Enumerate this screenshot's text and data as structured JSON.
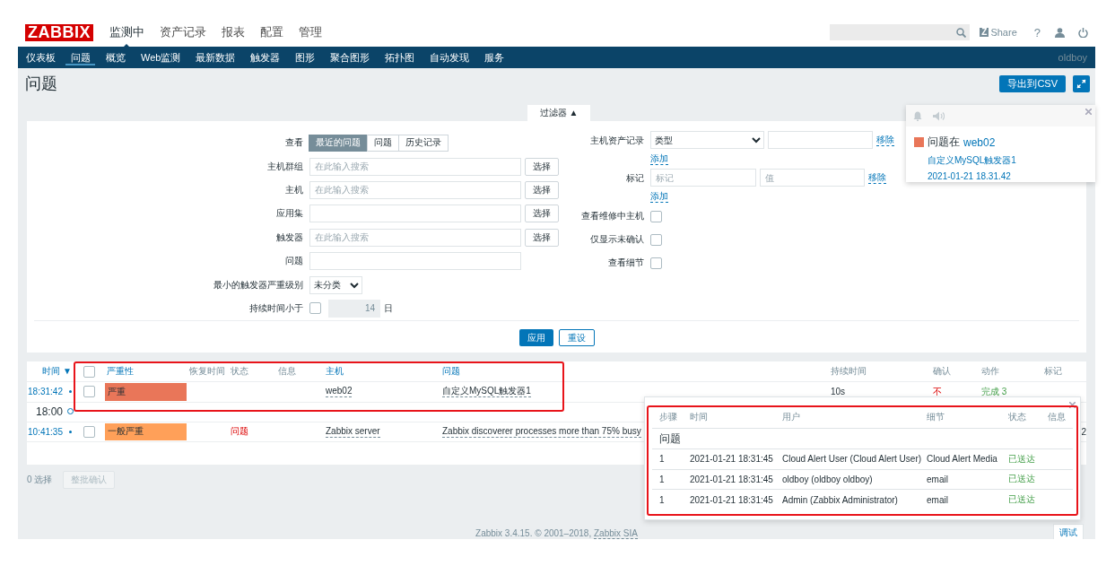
{
  "logo": "ZABBIX",
  "main_menu": [
    {
      "label": "监测中",
      "selected": true
    },
    {
      "label": "资产记录",
      "selected": false
    },
    {
      "label": "报表",
      "selected": false
    },
    {
      "label": "配置",
      "selected": false
    },
    {
      "label": "管理",
      "selected": false
    }
  ],
  "header_tools": {
    "share_badge": "Z",
    "share": "Share",
    "help": "?"
  },
  "sub_menu": [
    {
      "label": "仪表板",
      "selected": false
    },
    {
      "label": "问题",
      "selected": true
    },
    {
      "label": "概览",
      "selected": false
    },
    {
      "label": "Web监测",
      "selected": false
    },
    {
      "label": "最新数据",
      "selected": false
    },
    {
      "label": "触发器",
      "selected": false
    },
    {
      "label": "图形",
      "selected": false
    },
    {
      "label": "聚合图形",
      "selected": false
    },
    {
      "label": "拓扑图",
      "selected": false
    },
    {
      "label": "自动发现",
      "selected": false
    },
    {
      "label": "服务",
      "selected": false
    }
  ],
  "user": "oldboy",
  "page_title": "问题",
  "export_button": "导出到CSV",
  "filter": {
    "tab": "过滤器",
    "toggle": "▲",
    "left": [
      {
        "kind": "segmented",
        "label": "查看",
        "options": [
          {
            "label": "最近的问题",
            "selected": true
          },
          {
            "label": "问题",
            "selected": false
          },
          {
            "label": "历史记录",
            "selected": false
          }
        ]
      },
      {
        "kind": "search",
        "label": "主机群组",
        "placeholder": "在此输入搜索",
        "button": "选择"
      },
      {
        "kind": "search",
        "label": "主机",
        "placeholder": "在此输入搜索",
        "button": "选择"
      },
      {
        "kind": "search",
        "label": "应用集",
        "button": "选择"
      },
      {
        "kind": "search",
        "label": "触发器",
        "placeholder": "在此输入搜索",
        "button": "选择"
      },
      {
        "kind": "text",
        "label": "问题"
      },
      {
        "kind": "select",
        "label": "最小的触发器严重级别",
        "value": "未分类"
      },
      {
        "kind": "duration",
        "label": "持续时间小于",
        "checked": false,
        "value": "14",
        "unit": "日",
        "disabled": true
      }
    ],
    "right": [
      {
        "kind": "inventory",
        "label": "主机资产记录",
        "value": "类型",
        "remove": "移除",
        "add": "添加"
      },
      {
        "kind": "tags",
        "label": "标记",
        "tag_placeholder": "标记",
        "value_placeholder": "值",
        "remove": "移除",
        "add": "添加"
      },
      {
        "kind": "checkbox",
        "label": "查看维修中主机",
        "checked": false
      },
      {
        "kind": "checkbox",
        "label": "仅显示未确认",
        "checked": false
      },
      {
        "kind": "checkbox",
        "label": "查看细节",
        "checked": false
      }
    ],
    "apply": "应用",
    "reset": "重设"
  },
  "table": {
    "columns": [
      {
        "kind": "text",
        "label": "时间",
        "sortable": true,
        "sort_mark": "▼"
      },
      {
        "kind": "checkbox",
        "checked": false
      },
      {
        "kind": "text",
        "label": "严重性",
        "sortable": true
      },
      {
        "kind": "text",
        "label": "恢复时间",
        "sortable": false
      },
      {
        "kind": "text",
        "label": "状态",
        "sortable": false
      },
      {
        "kind": "text",
        "label": "信息",
        "sortable": false
      },
      {
        "kind": "text",
        "label": "主机",
        "sortable": true
      },
      {
        "kind": "text",
        "label": "问题",
        "sortable": true
      },
      {
        "kind": "text",
        "label": "持续时间",
        "sortable": false
      },
      {
        "kind": "text",
        "label": "确认",
        "sortable": false
      },
      {
        "kind": "text",
        "label": "动作",
        "sortable": false
      },
      {
        "kind": "text",
        "label": "标记",
        "sortable": false
      }
    ],
    "rows": [
      {
        "kind": "event",
        "time": "18:31:42",
        "checked": false,
        "severity": "严重",
        "color": "#e97659",
        "host": "web02",
        "problem": "自定义MySQL触发器1",
        "duration": "10s",
        "ack": "不",
        "actions": "完成 3"
      },
      {
        "kind": "marker",
        "time": "18:00"
      },
      {
        "kind": "event",
        "time": "10:41:35",
        "checked": false,
        "severity": "一般严重",
        "color": "#ffa059",
        "status": "问题",
        "host": "Zabbix server",
        "problem": "Zabbix discoverer processes more than 75% busy",
        "tags": "2"
      }
    ]
  },
  "selected_count": "0 选择",
  "mass_ack": {
    "label": "整批确认",
    "disabled": true
  },
  "footer": {
    "text": "Zabbix 3.4.15. © 2001–2018, ",
    "link": "Zabbix SIA",
    "debug": "调试"
  },
  "notification": {
    "color": "#e97659",
    "title": "问题在",
    "host": "web02",
    "trigger": "自定义MySQL触发器1",
    "time": "2021-01-21 18.31.42"
  },
  "actions_popup": {
    "columns": [
      "步骤",
      "时间",
      "用户",
      "细节",
      "状态",
      "信息"
    ],
    "section": "问题",
    "rows": [
      {
        "step": "1",
        "time": "2021-01-21 18:31:45",
        "user": "Cloud Alert User (Cloud Alert User)",
        "details": "Cloud Alert Media",
        "status": "已送达"
      },
      {
        "step": "1",
        "time": "2021-01-21 18:31:45",
        "user": "oldboy (oldboy oldboy)",
        "details": "email",
        "status": "已送达"
      },
      {
        "step": "1",
        "time": "2021-01-21 18:31:45",
        "user": "Admin (Zabbix Administrator)",
        "details": "email",
        "status": "已送达"
      }
    ]
  }
}
